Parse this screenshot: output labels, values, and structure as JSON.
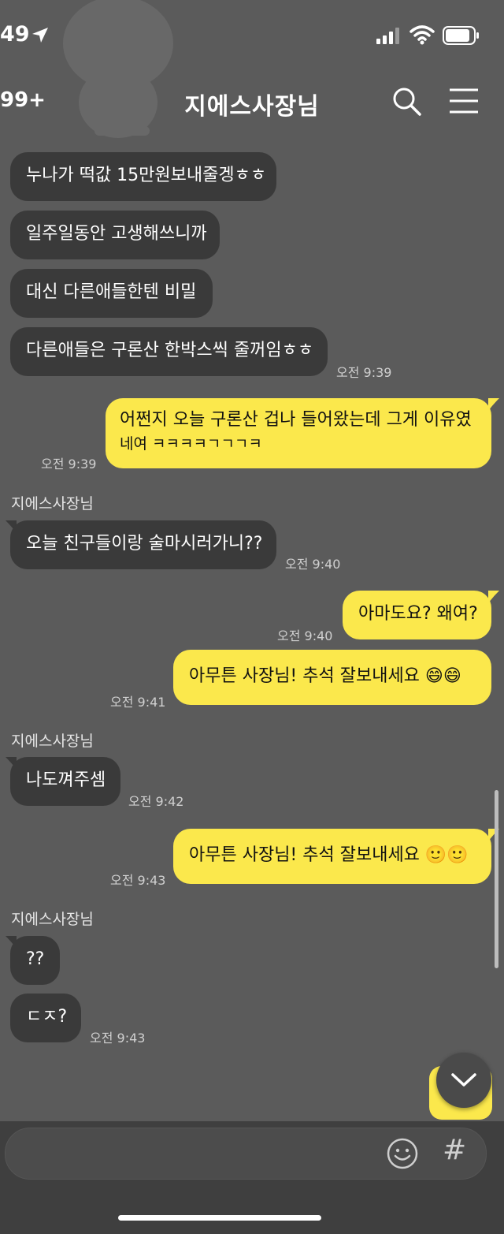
{
  "status_bar": {
    "time": "49",
    "icons": [
      "location-arrow-icon",
      "signal-icon",
      "wifi-icon",
      "battery-icon"
    ]
  },
  "header": {
    "back_count": "99+",
    "title": "지에스사장님",
    "icons": [
      "search-icon",
      "menu-icon"
    ]
  },
  "messages": [
    {
      "type": "in",
      "text": "누나가 떡값 15만원보내줄겡ㅎㅎ"
    },
    {
      "type": "in",
      "text": "일주일동안 고생해쓰니까"
    },
    {
      "type": "in",
      "text": "대신 다른애들한텐 비밀"
    },
    {
      "type": "in",
      "text": "다른애들은 구론산 한박스씩 줄꺼임ㅎㅎ",
      "time": "오전 9:39"
    },
    {
      "type": "out",
      "line1": "어쩐지 오늘 구론산 겁나 들어왔는데 그게 이유였",
      "line2": "네여 ㅋㅋㅋㅋㄱㄱㄱㅋ",
      "time": "오전 9:39"
    },
    {
      "type": "sender",
      "text": "지에스사장님"
    },
    {
      "type": "in",
      "text": "오늘 친구들이랑 술마시러가니??",
      "time": "오전 9:40"
    },
    {
      "type": "out",
      "text": "아마도요? 왜여?",
      "time": "오전 9:40"
    },
    {
      "type": "out",
      "text": "아무튼 사장님! 추석 잘보내세요 😄😄",
      "time": "오전 9:41"
    },
    {
      "type": "sender",
      "text": "지에스사장님"
    },
    {
      "type": "in",
      "text": "나도껴주셈",
      "time": "오전 9:42"
    },
    {
      "type": "out",
      "text": "아무튼 사장님! 추석 잘보내세요 🙂🙂",
      "time": "오전 9:43"
    },
    {
      "type": "sender",
      "text": "지에스사장님"
    },
    {
      "type": "in",
      "text": "??"
    },
    {
      "type": "in",
      "text": "ㄷㅈ?",
      "time": "오전 9:43"
    }
  ],
  "input_bar": {
    "icons": [
      "emoji-icon"
    ],
    "hash_label": "#"
  },
  "scroll_down_icon": "chevron-down-icon",
  "colors": {
    "background": "#5b5b5b",
    "incoming_bubble": "#3a3a3a",
    "outgoing_bubble": "#fbe84c"
  }
}
